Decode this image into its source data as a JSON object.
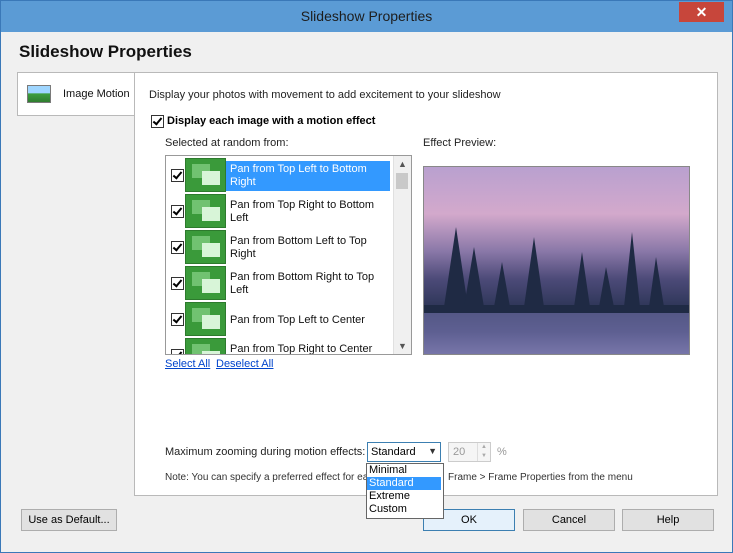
{
  "window": {
    "title": "Slideshow Properties",
    "close_glyph": "✕"
  },
  "page_title": "Slideshow Properties",
  "nav": {
    "items": [
      {
        "label": "Image Motion",
        "icon": "landscape-icon"
      }
    ]
  },
  "panel": {
    "description": "Display your photos with movement to add excitement to your slideshow",
    "main_checkbox_label": "Display each image with a motion effect",
    "list_label": "Selected at random from:",
    "preview_label": "Effect Preview:",
    "effects": [
      {
        "label": "Pan from Top Left to Bottom Right",
        "checked": true,
        "selected": true
      },
      {
        "label": "Pan from Top Right to Bottom Left",
        "checked": true,
        "selected": false
      },
      {
        "label": "Pan from Bottom Left to Top Right",
        "checked": true,
        "selected": false
      },
      {
        "label": "Pan from Bottom Right to Top Left",
        "checked": true,
        "selected": false
      },
      {
        "label": "Pan from Top Left to Center",
        "checked": true,
        "selected": false
      },
      {
        "label": "Pan from Top Right to Center",
        "checked": true,
        "selected": false
      }
    ],
    "select_all": "Select All",
    "deselect_all": "Deselect All",
    "zoom_label": "Maximum zooming during motion effects:",
    "zoom_value": "Standard",
    "zoom_options": [
      "Minimal",
      "Standard",
      "Extreme",
      "Custom"
    ],
    "custom_percent": "20",
    "percent_sign": "%",
    "note_left": "Note: You can specify a preferred effect for each",
    "note_right": "Frame > Frame Properties from the menu"
  },
  "buttons": {
    "use_default": "Use as Default...",
    "ok": "OK",
    "cancel": "Cancel",
    "help": "Help"
  }
}
